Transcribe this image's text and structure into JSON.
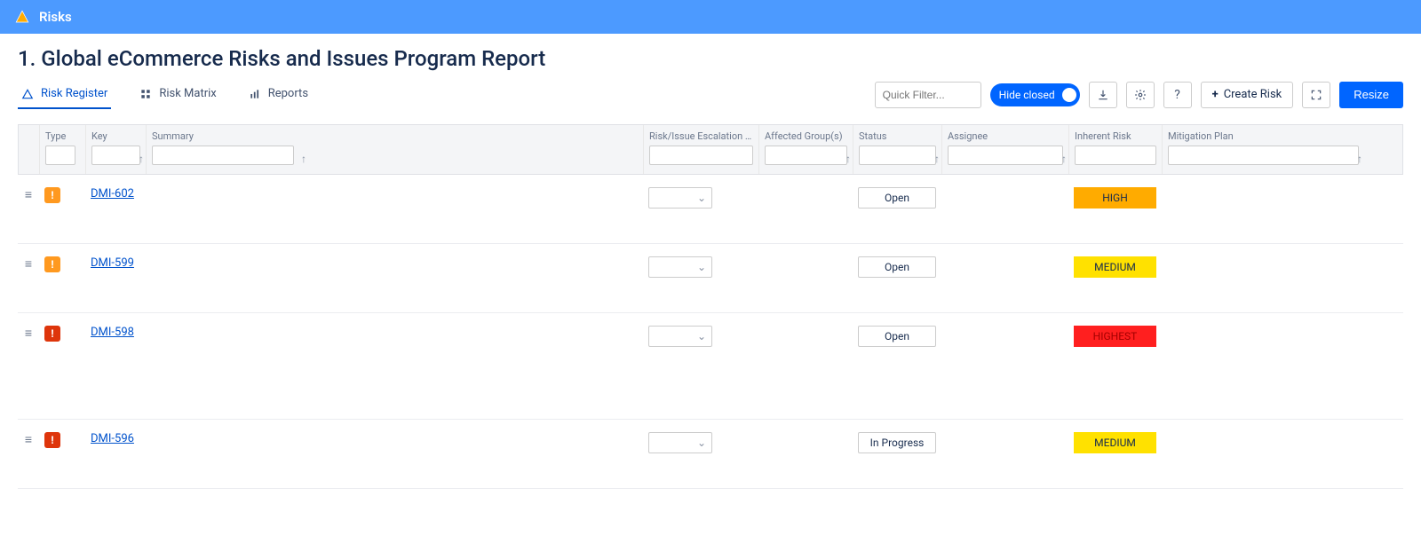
{
  "banner": {
    "title": "Risks"
  },
  "page": {
    "title": "1. Global eCommerce Risks and Issues Program Report"
  },
  "tabs": [
    {
      "label": "Risk Register",
      "icon": "warning",
      "active": true
    },
    {
      "label": "Risk Matrix",
      "icon": "matrix",
      "active": false
    },
    {
      "label": "Reports",
      "icon": "chart",
      "active": false
    }
  ],
  "controls": {
    "quick_filter_placeholder": "Quick Filter...",
    "hide_closed_label": "Hide closed",
    "create_risk_label": "Create Risk",
    "resize_label": "Resize"
  },
  "columns": [
    {
      "label": ""
    },
    {
      "label": "Type"
    },
    {
      "label": "Key",
      "sort": "asc"
    },
    {
      "label": "Summary",
      "sort": "asc"
    },
    {
      "label": "Risk/Issue Escalation Level"
    },
    {
      "label": "Affected Group(s)",
      "sort": "asc"
    },
    {
      "label": "Status"
    },
    {
      "label": "Assignee",
      "sort": "asc"
    },
    {
      "label": "Inherent Risk"
    },
    {
      "label": "Mitigation Plan",
      "sort": "asc"
    }
  ],
  "rows": [
    {
      "type_color": "orange",
      "key": "DMI-602",
      "status": "Open",
      "inherent_risk": "HIGH",
      "ir_class": "ir-high",
      "tall": false
    },
    {
      "type_color": "orange",
      "key": "DMI-599",
      "status": "Open",
      "inherent_risk": "MEDIUM",
      "ir_class": "ir-medium",
      "tall": false
    },
    {
      "type_color": "red",
      "key": "DMI-598",
      "status": "Open",
      "inherent_risk": "HIGHEST",
      "ir_class": "ir-highest",
      "tall": true
    },
    {
      "type_color": "red",
      "key": "DMI-596",
      "status": "In Progress",
      "inherent_risk": "MEDIUM",
      "ir_class": "ir-medium",
      "tall": false
    }
  ]
}
